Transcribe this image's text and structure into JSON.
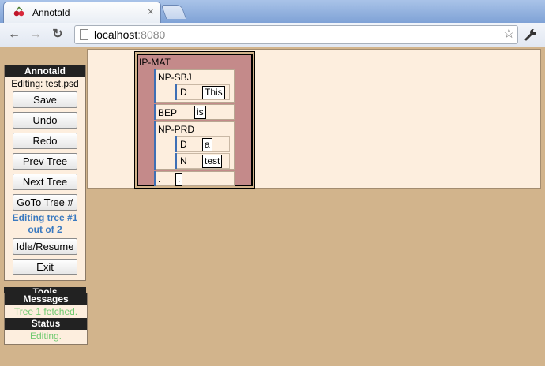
{
  "browser": {
    "tab_title": "Annotald",
    "tab_close": "×",
    "url_host": "localhost",
    "url_port": ":8080",
    "back_icon": "←",
    "forward_icon": "→",
    "reload_icon": "↻",
    "star_icon": "☆"
  },
  "controls": {
    "header": "Annotald",
    "editing_file": "Editing: test.psd",
    "buttons": [
      "Save",
      "Undo",
      "Redo",
      "Prev Tree",
      "Next Tree",
      "GoTo Tree #",
      "Idle/Resume",
      "Exit"
    ],
    "tree_status_line1": "Editing tree #1",
    "tree_status_line2": "out of 2"
  },
  "tools": {
    "header": "Tools"
  },
  "messages": {
    "header": "Messages",
    "text": "Tree 1 fetched."
  },
  "status": {
    "header": "Status",
    "text": "Editing."
  },
  "tree": {
    "root": "IP-MAT",
    "np_sbj": {
      "label": "NP-SBJ",
      "d_label": "D",
      "d_word": "This"
    },
    "bep": {
      "label": "BEP",
      "word": "is"
    },
    "np_prd": {
      "label": "NP-PRD",
      "d_label": "D",
      "d_word": "a",
      "n_label": "N",
      "n_word": "test"
    },
    "punct": {
      "label": ".",
      "word": "."
    }
  },
  "colors": {
    "background": "#d2b48c",
    "panel": "#fdeede",
    "ip_mat": "#c48a8a",
    "node_bar": "#3e6fb5",
    "status_green": "#6fca6f",
    "tree_status_blue": "#3b7ac0"
  }
}
